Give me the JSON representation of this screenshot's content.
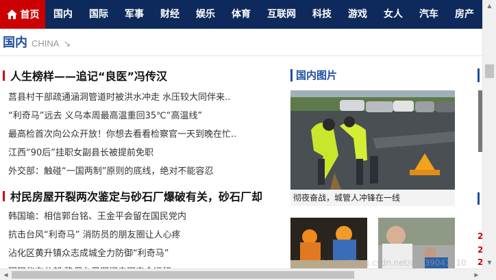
{
  "nav": {
    "home_label": "首页",
    "items": [
      "国内",
      "国际",
      "军事",
      "财经",
      "娱乐",
      "体育",
      "互联网",
      "科技",
      "游戏",
      "女人",
      "汽车",
      "房产"
    ]
  },
  "section": {
    "title": "国内",
    "subtitle": "CHINA",
    "arrow": "↘"
  },
  "headlines": [
    {
      "title": "人生榜样——追记“良医”冯传汉",
      "items": [
        "莒县村干部疏通涵洞管道时被洪水冲走 水压较大同伴来..",
        "“利奇马”远去 义乌本周最高温重回35℃“高温线”",
        "最高检首次向公众开放！你想去看看检察官一天到晚在忙..",
        "江西“90后”挂职女副县长被提前免职",
        "外交部：触碰“一国两制”原则的底线，绝对不能容忍"
      ]
    },
    {
      "title": "村民房屋开裂两次鉴定与砂石厂爆破有关，砂石厂却",
      "items": [
        "韩国瑜：相信郭台铭、王金平会留在国民党内",
        "抗击台风“利奇马” 消防员的朋友圈让人心疼",
        "沾化区黄升镇众志成城全力防御“利奇马”",
        "国网华东分部 确保台风期间电网安全运行"
      ]
    }
  ],
  "pictures": {
    "title": "国内图片",
    "main_caption": "彻夜奋战，城管人冲锋在一线"
  },
  "right_edge": {
    "red_chars": [
      "2",
      "2",
      "2"
    ]
  },
  "watermark": "https://blog.csdn.net/qq_39041210",
  "colors": {
    "nav_bg": "#0e2a5c",
    "home_active": "#cc0000",
    "accent_blue": "#1f4e9e",
    "accent_red": "#cc0000"
  }
}
